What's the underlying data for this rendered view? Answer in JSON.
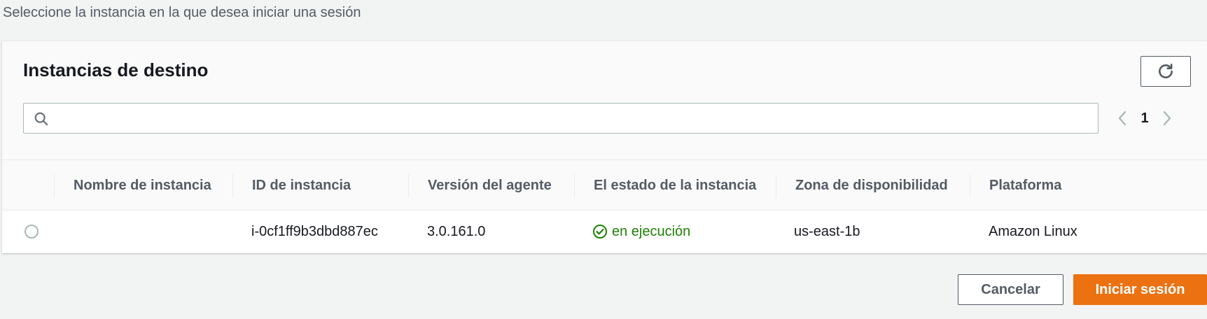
{
  "intro_text": "Seleccione la instancia en la que desea iniciar una sesión",
  "panel": {
    "title": "Instancias de destino",
    "refresh_icon": "refresh-icon",
    "search": {
      "value": "",
      "placeholder": "",
      "icon": "search-icon"
    },
    "pagination": {
      "current_page": "1"
    }
  },
  "table": {
    "columns": [
      "Nombre de instancia",
      "ID de instancia",
      "Versión del agente",
      "El estado de la instancia",
      "Zona de disponibilidad",
      "Plataforma"
    ],
    "rows": [
      {
        "selected": false,
        "name": "",
        "id": "i-0cf1ff9b3dbd887ec",
        "agent_version": "3.0.161.0",
        "state": "en ejecución",
        "state_icon": "check-circle-icon",
        "zone": "us-east-1b",
        "platform": "Amazon Linux"
      }
    ]
  },
  "actions": {
    "cancel_label": "Cancelar",
    "start_label": "Iniciar sesión"
  },
  "colors": {
    "accent": "#ec7211",
    "success": "#1d8102",
    "text": "#16191f",
    "muted": "#545b64",
    "border": "#aab7b8",
    "background": "#f2f3f3"
  }
}
